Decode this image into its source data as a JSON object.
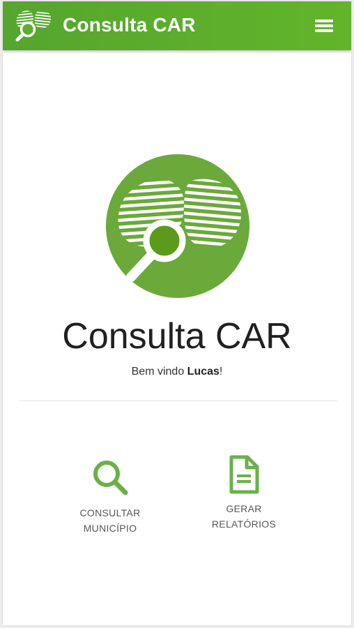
{
  "appbar": {
    "title": "Consulta CAR",
    "logo_icon": "magnifier-over-striped-lungs-logo",
    "menu_icon": "hamburger-menu-icon",
    "color": "#5cae2d"
  },
  "hero": {
    "logo_icon": "magnifier-over-striped-lungs-logo",
    "title": "Consulta CAR",
    "welcome_prefix": "Bem vindo ",
    "user_name": "Lucas",
    "welcome_suffix": "!"
  },
  "actions": [
    {
      "label": "CONSULTAR\nMUNICÍPIO",
      "icon": "search-icon"
    },
    {
      "label": "GERAR\nRELATÓRIOS",
      "icon": "document-icon"
    }
  ],
  "colors": {
    "brand_green": "#5cae2d",
    "icon_green": "#6ab04c",
    "logo_dark_green": "#4e9a1f"
  }
}
